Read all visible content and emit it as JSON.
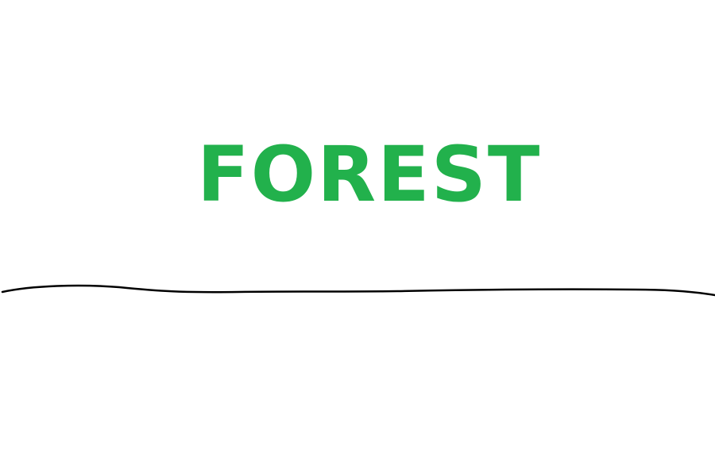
{
  "title": {
    "text": "FOREST",
    "color": "#22b14c"
  },
  "ground_line": {
    "color": "#000000"
  }
}
